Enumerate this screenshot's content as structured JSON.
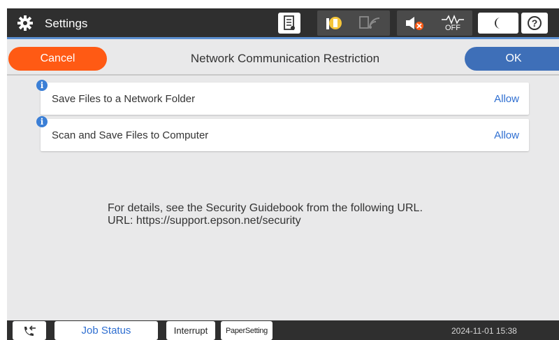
{
  "topbar": {
    "title": "Settings",
    "icons": [
      "gear-icon",
      "document-icon",
      "ink-icon",
      "copy-wifi-icon",
      "volume-muted-icon",
      "network-off-icon",
      "moon-icon",
      "help-icon"
    ],
    "network_off_label": "OFF",
    "help_label": "?"
  },
  "header": {
    "cancel_label": "Cancel",
    "title": "Network Communication Restriction",
    "ok_label": "OK"
  },
  "settings": [
    {
      "label": "Save Files to a Network Folder",
      "value": "Allow"
    },
    {
      "label": "Scan and Save Files to Computer",
      "value": "Allow"
    }
  ],
  "details": {
    "line1": "For details, see the Security Guidebook from the following URL.",
    "line2": "URL: https://support.epson.net/security"
  },
  "bottombar": {
    "job_status_label": "Job Status",
    "interrupt_label": "Interrupt",
    "paper_setting_label": "PaperSetting",
    "datetime": "2024-11-01 15:38"
  },
  "colors": {
    "cancel": "#ff5a14",
    "ok": "#3e6fb8",
    "accent_text": "#2f6fd1",
    "bar": "#2f2f2f"
  }
}
